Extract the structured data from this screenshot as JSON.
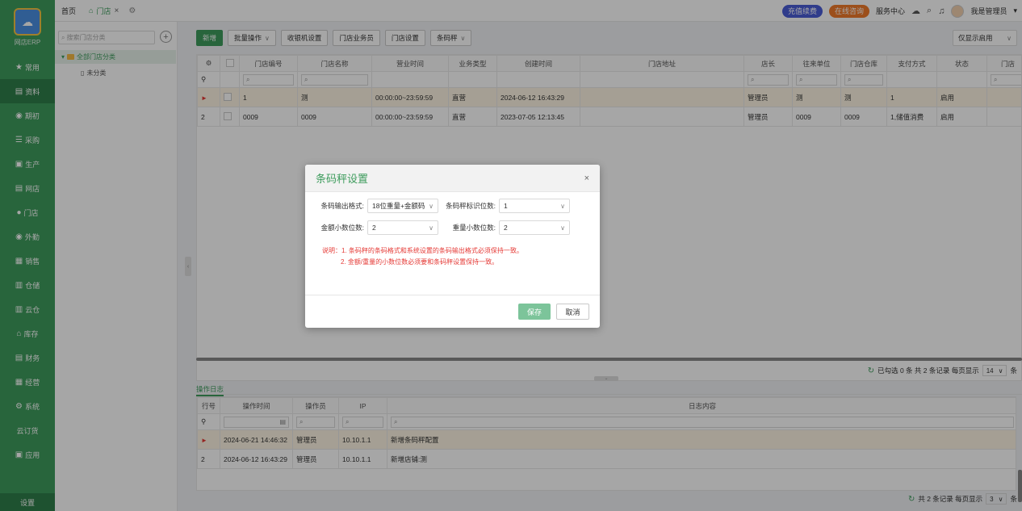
{
  "app": {
    "logo_text": "网店ERP",
    "logo_mark": "网上管家婆"
  },
  "nav": {
    "items": [
      {
        "label": "常用",
        "icon": "★"
      },
      {
        "label": "资料",
        "icon": "▤"
      },
      {
        "label": "期初",
        "icon": "◉"
      },
      {
        "label": "采购",
        "icon": "☰"
      },
      {
        "label": "生产",
        "icon": "▣"
      },
      {
        "label": "网店",
        "icon": "▤"
      },
      {
        "label": "门店",
        "icon": "●"
      },
      {
        "label": "外勤",
        "icon": "◉"
      },
      {
        "label": "销售",
        "icon": "▦"
      },
      {
        "label": "仓储",
        "icon": "▥"
      },
      {
        "label": "云仓",
        "icon": "▥"
      },
      {
        "label": "库存",
        "icon": "⌂"
      },
      {
        "label": "财务",
        "icon": "▤"
      },
      {
        "label": "经营",
        "icon": "▦"
      },
      {
        "label": "系统",
        "icon": "⚙"
      },
      {
        "label": "云订货",
        "icon": ""
      },
      {
        "label": "应用",
        "icon": "▣"
      }
    ],
    "settings": "设置"
  },
  "topbar": {
    "home_tab": "首页",
    "active_tab": "门店",
    "recharge": "充值续费",
    "consult": "在线咨询",
    "service": "服务中心",
    "user": "我是管理员"
  },
  "tree": {
    "search_placeholder": "搜索门店分类",
    "root": "全部门店分类",
    "child": "未分类"
  },
  "toolbar": {
    "new": "新增",
    "batch": "批量操作",
    "cashier": "收银机设置",
    "staff": "门店业务员",
    "store_settings": "门店设置",
    "scale": "条码秤",
    "filter": "仅显示启用"
  },
  "grid": {
    "headers": [
      "门店编号",
      "门店名称",
      "营业时间",
      "业务类型",
      "创建时间",
      "门店地址",
      "店长",
      "往来单位",
      "门店仓库",
      "支付方式",
      "状态",
      "门店"
    ],
    "rows": [
      {
        "idx": "",
        "code": "1",
        "name": "测",
        "hours": "00:00:00~23:59:59",
        "type": "直营",
        "created": "2024-06-12 16:43:29",
        "address": "",
        "manager": "管理员",
        "partner": "测",
        "warehouse": "测",
        "pay": "1",
        "status": "启用"
      },
      {
        "idx": "2",
        "code": "0009",
        "name": "0009",
        "hours": "00:00:00~23:59:59",
        "type": "直营",
        "created": "2023-07-05 12:13:45",
        "address": "",
        "manager": "管理员",
        "partner": "0009",
        "warehouse": "0009",
        "pay": "1,储值消费",
        "status": "启用"
      }
    ],
    "pager": {
      "text": "已勾选 0 条 共 2 条记录 每页显示",
      "size": "14",
      "unit": "条"
    }
  },
  "log": {
    "title": "操作日志",
    "headers": [
      "行号",
      "操作时间",
      "操作员",
      "IP",
      "日志内容"
    ],
    "rows": [
      {
        "idx": "",
        "time": "2024-06-21 14:46:32",
        "operator": "管理员",
        "ip": "10.10.1.1",
        "content": "新增条码秤配置"
      },
      {
        "idx": "2",
        "time": "2024-06-12 16:43:29",
        "operator": "管理员",
        "ip": "10.10.1.1",
        "content": "新增店铺:测"
      }
    ],
    "pager": {
      "text": "共 2 条记录 每页显示",
      "size": "3",
      "unit": "条"
    }
  },
  "modal": {
    "title": "条码秤设置",
    "format_label": "条码输出格式:",
    "format_value": "18位重量+金额码",
    "flag_label": "条码秤标识位数:",
    "flag_value": "1",
    "amount_label": "金额小数位数:",
    "amount_value": "2",
    "weight_label": "重量小数位数:",
    "weight_value": "2",
    "note1": "说明：1. 条码秤的条码格式和系统设置的条码输出格式必须保持一致。",
    "note2": "2. 金额/重量的小数位数必须要和条码秤设置保持一致。",
    "save": "保存",
    "cancel": "取消"
  },
  "colors": {
    "accent": "#3e9c5d",
    "danger": "#e53935"
  }
}
